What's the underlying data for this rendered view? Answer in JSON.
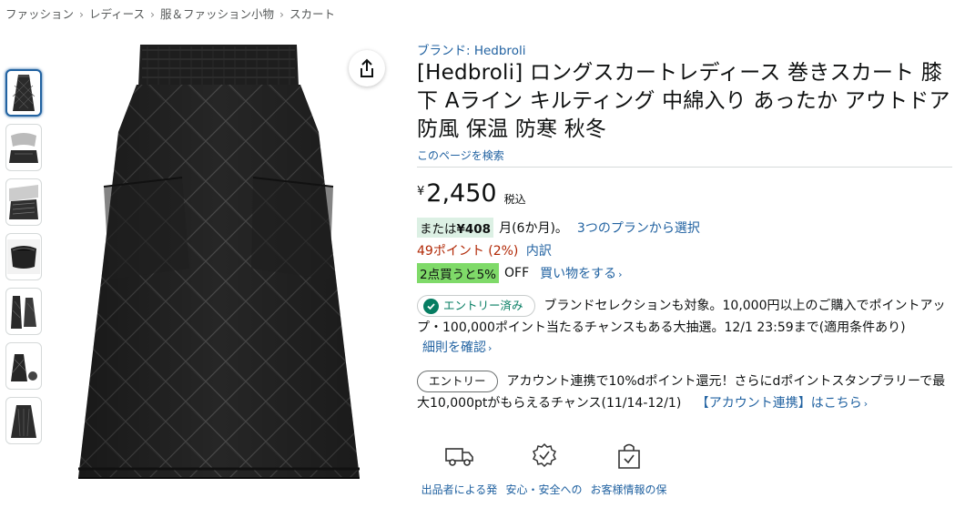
{
  "breadcrumb": [
    "ファッション",
    "レディース",
    "服＆ファッション小物",
    "スカート"
  ],
  "product": {
    "brand": "ブランド: Hedbroli",
    "title": "[Hedbroli] ロングスカートレディース 巻きスカート 膝下 Aライン キルティング 中綿入り あったか アウトドア 防風 保温 防寒 秋冬",
    "search_link": "このページを検索"
  },
  "price": {
    "symbol": "¥",
    "value": "2,450",
    "tax": "税込"
  },
  "installment": {
    "badge_prefix": "または",
    "badge_amount": "¥408",
    "text": "月(6か月)。",
    "link": "3つのプランから選択"
  },
  "points": {
    "value": "49ポイント (2%)",
    "detail": "内訳"
  },
  "promo": {
    "badge": "2点買うと5%",
    "off": "OFF",
    "link": "買い物をする"
  },
  "entry1": {
    "pill": "エントリー済み",
    "text": "ブランドセレクションも対象。10,000円以上のご購入でポイントアップ・100,000ポイント当たるチャンスもある大抽選。12/1 23:59まで(適用条件あり)",
    "link": "細則を確認"
  },
  "entry2": {
    "pill": "エントリー",
    "text": "アカウント連携で10%dポイント還元！さらにdポイントスタンプラリーで最大10,000ptがもらえるチャンス(11/14-12/1)",
    "link": "【アカウント連携】はこちら"
  },
  "features": [
    {
      "icon": "truck-icon",
      "label": "出品者による発"
    },
    {
      "icon": "badge-check-icon",
      "label": "安心・安全への"
    },
    {
      "icon": "secure-bag-icon",
      "label": "お客様情報の保"
    }
  ],
  "colors": {
    "link": "#2162a1",
    "points": "#b12704",
    "promo_badge": "#7fda69",
    "install_badge": "#dcf0e4",
    "entry_check": "#067d62"
  },
  "icons": {
    "share": "share-icon",
    "check": "check-icon",
    "chevron": "chevron-right-icon"
  }
}
